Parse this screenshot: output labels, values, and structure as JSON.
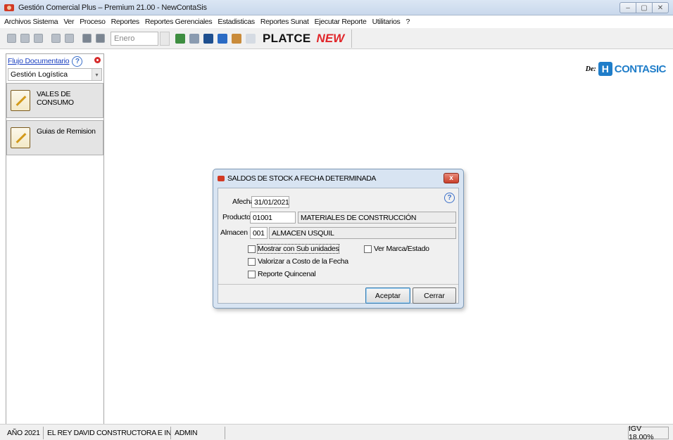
{
  "window": {
    "title": "Gestión Comercial Plus – Premium 21.00 - NewContaSis",
    "controls": [
      "–",
      "▢",
      "✕"
    ]
  },
  "menu": [
    "Archivos Sistema",
    "Ver",
    "Proceso",
    "Reportes",
    "Reportes Gerenciales",
    "Estadisticas",
    "Reportes Sunat",
    "Ejecutar Reporte",
    "Utilitarios",
    "?"
  ],
  "toolbar": {
    "month": "Enero",
    "platce": "PLATCE",
    "platce_new": "NEW"
  },
  "left_panel": {
    "flujo_link": "Flujo Documentario",
    "help": "?",
    "gestion_select": "Gestión Logística",
    "modules": [
      {
        "label": "VALES DE CONSUMO"
      },
      {
        "label": "Guias de Remision"
      }
    ]
  },
  "brand": {
    "prefix": "De:",
    "box": "H",
    "name": "CONTASIC"
  },
  "dialog": {
    "title": "SALDOS DE STOCK A FECHA DETERMINADA",
    "close": "x",
    "help": "?",
    "fecha_label": "Afecha",
    "fecha_value": "31/01/2021",
    "producto_label": "Producto",
    "producto_code": "01001",
    "producto_name": "MATERIALES DE CONSTRUCCIÓN",
    "almacen_label": "Almacen",
    "almacen_code": "001",
    "almacen_name": "ALMACEN USQUIL",
    "checkboxes": {
      "sub_unidades": "Mostrar con Sub unidades",
      "marca_estado": "Ver Marca/Estado",
      "valorizar": "Valorizar a Costo de la Fecha",
      "quincenal": "Reporte Quincenal"
    },
    "accept": "Aceptar",
    "close_btn": "Cerrar"
  },
  "status": {
    "year": "AÑO 2021",
    "company": "EL REY DAVID CONSTRUCTORA E INMOBILI/",
    "user": "ADMIN",
    "igv": "IGV 18.00%"
  },
  "colors": {
    "accent_brand": "#1f7dc9",
    "platce_new": "#e0262a",
    "dialog_frame": "#d8e4f2"
  }
}
